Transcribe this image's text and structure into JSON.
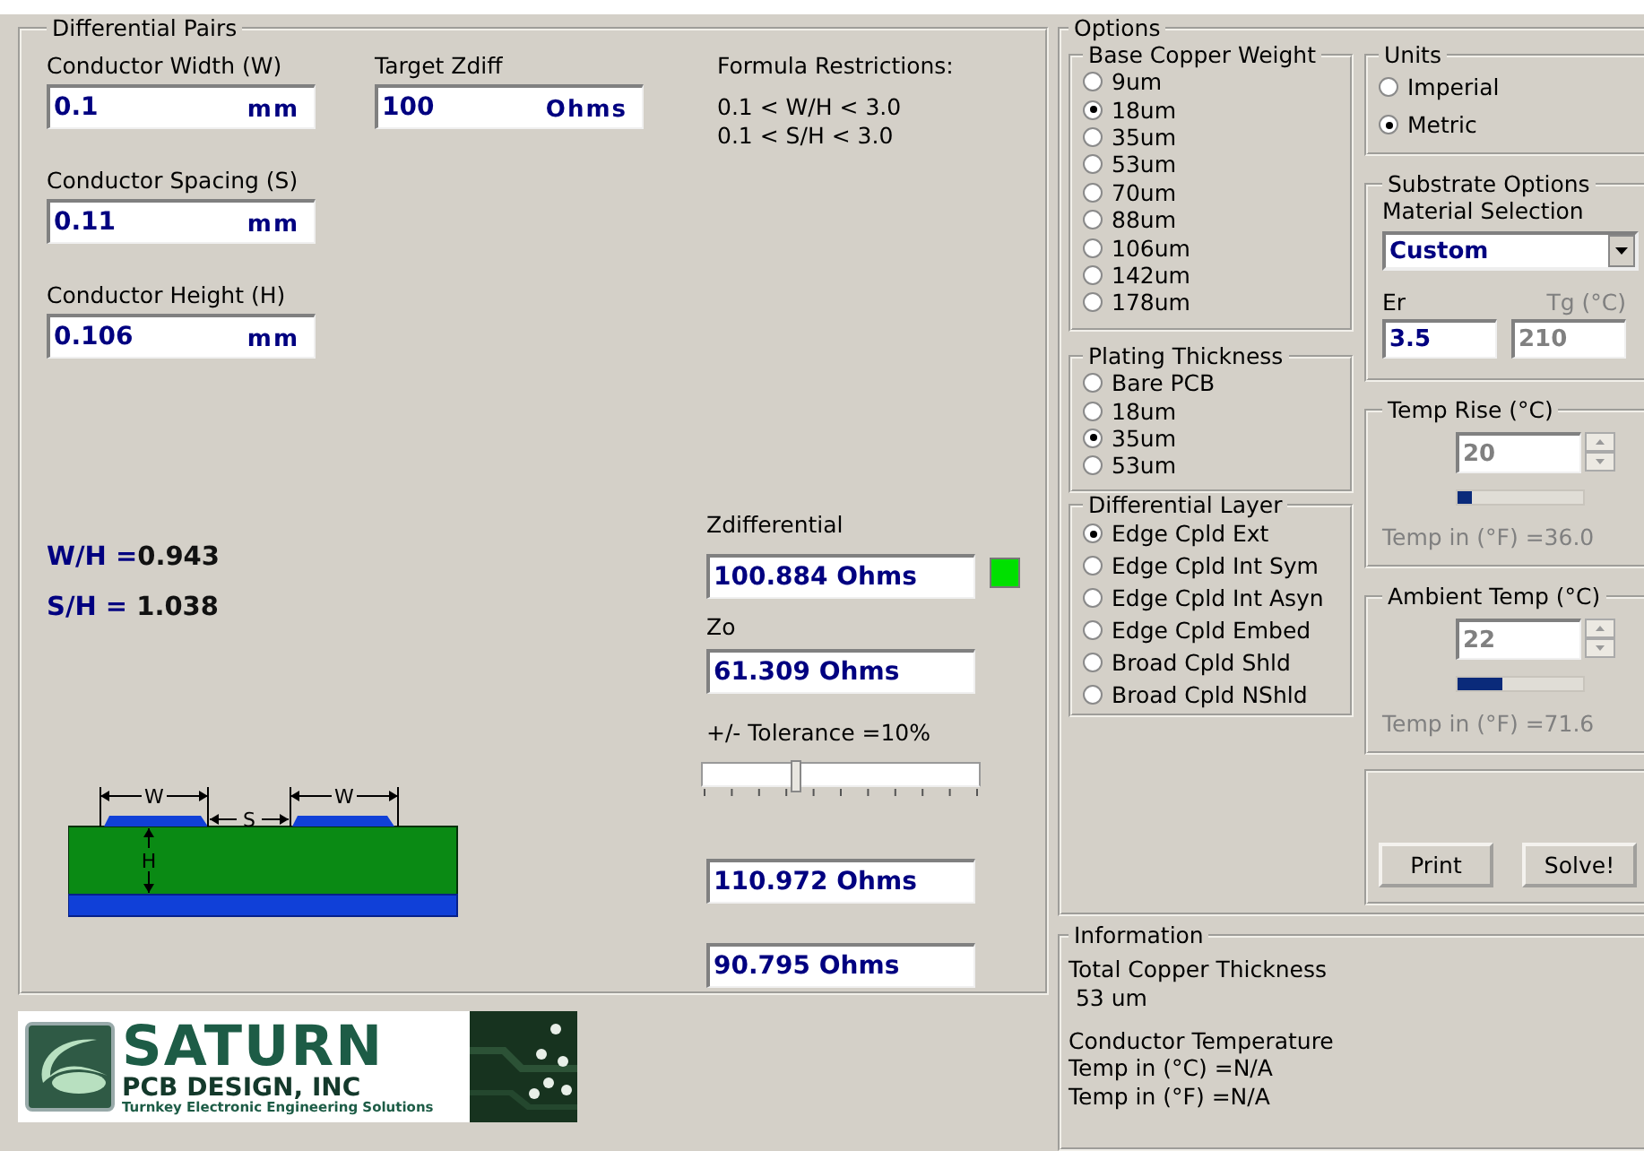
{
  "differential_pairs": {
    "title": "Differential Pairs",
    "inputs": [
      {
        "label": "Conductor Width (W)",
        "value": "0.1",
        "unit": "mm"
      },
      {
        "label": "Conductor Spacing (S)",
        "value": "0.11",
        "unit": "mm"
      },
      {
        "label": "Conductor Height (H)",
        "value": "0.106",
        "unit": "mm"
      }
    ],
    "target": {
      "label": "Target Zdiff",
      "value": "100",
      "unit": "Ohms"
    },
    "restrictions": {
      "title": "Formula Restrictions:",
      "lines": [
        "0.1 < W/H < 3.0",
        "0.1 < S/H < 3.0"
      ]
    },
    "ratios": [
      {
        "label": "W/H =",
        "value": "0.943"
      },
      {
        "label": "S/H = ",
        "value": "1.038"
      }
    ],
    "diagram": {
      "labels": [
        "W",
        "S",
        "W",
        "H"
      ]
    },
    "zdiff": {
      "label": "Zdifferential",
      "value": "100.884 Ohms",
      "within_tolerance": true
    },
    "zo": {
      "label": "Zo",
      "value": "61.309 Ohms"
    },
    "tolerance": {
      "label": "+/- Tolerance =10%",
      "level": 0.34
    },
    "bounds": [
      "110.972 Ohms",
      "90.795 Ohms"
    ]
  },
  "logo": {
    "name": "SATURN",
    "subtitle": "PCB DESIGN, INC",
    "tagline": "Turnkey Electronic Engineering Solutions"
  },
  "options": {
    "title": "Options",
    "copper": {
      "title": "Base Copper Weight",
      "items": [
        {
          "label": "9um",
          "selected": false
        },
        {
          "label": "18um",
          "selected": true
        },
        {
          "label": "35um",
          "selected": false
        },
        {
          "label": "53um",
          "selected": false
        },
        {
          "label": "70um",
          "selected": false
        },
        {
          "label": "88um",
          "selected": false
        },
        {
          "label": "106um",
          "selected": false
        },
        {
          "label": "142um",
          "selected": false
        },
        {
          "label": "178um",
          "selected": false
        }
      ]
    },
    "plating": {
      "title": "Plating Thickness",
      "items": [
        {
          "label": "Bare PCB",
          "selected": false
        },
        {
          "label": "18um",
          "selected": false
        },
        {
          "label": "35um",
          "selected": true
        },
        {
          "label": "53um",
          "selected": false
        }
      ]
    },
    "layer": {
      "title": "Differential Layer",
      "items": [
        {
          "label": "Edge Cpld Ext",
          "selected": true
        },
        {
          "label": "Edge Cpld Int Sym",
          "selected": false
        },
        {
          "label": "Edge Cpld Int Asyn",
          "selected": false
        },
        {
          "label": "Edge Cpld Embed",
          "selected": false
        },
        {
          "label": "Broad Cpld Shld",
          "selected": false
        },
        {
          "label": "Broad Cpld NShld",
          "selected": false
        }
      ]
    },
    "units": {
      "title": "Units",
      "items": [
        {
          "label": "Imperial",
          "selected": false
        },
        {
          "label": "Metric",
          "selected": true
        }
      ]
    },
    "substrate": {
      "title": "Substrate Options",
      "material_label": "Material Selection",
      "material": "Custom",
      "er_label": "Er",
      "er": "3.5",
      "tg_label": "Tg (°C)",
      "tg": "210",
      "tg_disabled": true
    },
    "temp_rise": {
      "title": "Temp Rise (°C)",
      "value": "20",
      "level": 0.12,
      "reading": "Temp in (°F) =36.0",
      "disabled": true
    },
    "ambient": {
      "title": "Ambient Temp (°C)",
      "value": "22",
      "level": 0.35,
      "reading": "Temp in (°F) =71.6",
      "disabled": true
    },
    "buttons": [
      "Print",
      "Solve!"
    ]
  },
  "information": {
    "title": "Information",
    "lines": [
      "Total Copper Thickness",
      " 53 um",
      "Conductor Temperature",
      "Temp in (°C) =N/A",
      "Temp in (°F) =N/A"
    ]
  }
}
